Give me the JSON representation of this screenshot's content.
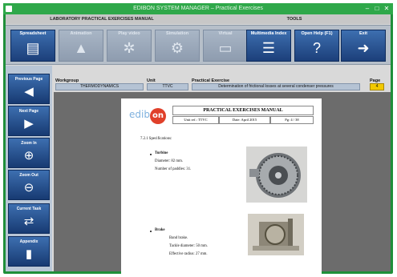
{
  "window": {
    "title": "EDIBON SYSTEM MANAGER – Practical Exercises",
    "minimize": "–",
    "maximize": "□",
    "close": "✕"
  },
  "sections": {
    "manual": "LABORATORY PRACTICAL EXERCISES MANUAL",
    "tools": "TOOLS"
  },
  "toolbar": {
    "items": [
      {
        "label": "Spreadsheet",
        "icon": "spreadsheet-icon",
        "glyph": "▤"
      },
      {
        "label": "Animation",
        "icon": "animation-icon",
        "glyph": "▲"
      },
      {
        "label": "Play video",
        "icon": "video-reel-icon",
        "glyph": "✲"
      },
      {
        "label": "Simulation",
        "icon": "simulation-icon",
        "glyph": "⚙"
      },
      {
        "label": "Virtual",
        "icon": "virtual-icon",
        "glyph": "▭"
      },
      {
        "label": "Multimedia Index",
        "icon": "multimedia-index-icon",
        "glyph": "☰"
      },
      {
        "label": "Open Help (F1)",
        "icon": "help-icon",
        "glyph": "?"
      },
      {
        "label": "Exit",
        "icon": "exit-icon",
        "glyph": "➜"
      }
    ]
  },
  "sidebar": {
    "items": [
      {
        "label": "Previous Page",
        "icon": "previous-page-icon",
        "glyph": "◀"
      },
      {
        "label": "Next Page",
        "icon": "next-page-icon",
        "glyph": "▶"
      },
      {
        "label": "Zoom In",
        "icon": "zoom-in-icon",
        "glyph": "⊕"
      },
      {
        "label": "Zoom Out",
        "icon": "zoom-out-icon",
        "glyph": "⊖"
      },
      {
        "label": "Current Task",
        "icon": "current-task-icon",
        "glyph": "⇄"
      },
      {
        "label": "Appendix",
        "icon": "appendix-icon",
        "glyph": "▮"
      }
    ]
  },
  "info": {
    "workgroup_label": "Workgroup",
    "workgroup_value": "THERMODYNAMICS",
    "unit_label": "Unit",
    "unit_value": "TTVC",
    "exercise_label": "Practical Exercise",
    "exercise_value": "Determination of frictional losses at several condenser pressures",
    "page_label": "Page",
    "page_value": "4"
  },
  "document": {
    "logo_prefix": "edib",
    "logo_on": "on",
    "title": "PRACTICAL EXERCISES MANUAL",
    "unit": "Unit ref.: TTVC",
    "date": "Date: April 2015",
    "page": "Pg: 4 / 38",
    "section": "7.2.1   Specifications:",
    "turbine": "Turbine",
    "diameter": "Diameter: 82 mm.",
    "paddles": "Number of paddles: 31.",
    "brake": "Brake",
    "band": "Band brake.",
    "tackle": "Tackle diameter: 50 mm.",
    "radius": "Effective radius: 27 mm."
  },
  "colors": {
    "window": "#1f8f3a",
    "toolbar_button": "#2a5596",
    "page_badge": "#f2c900",
    "viewer_bg": "#6c6c6c"
  }
}
